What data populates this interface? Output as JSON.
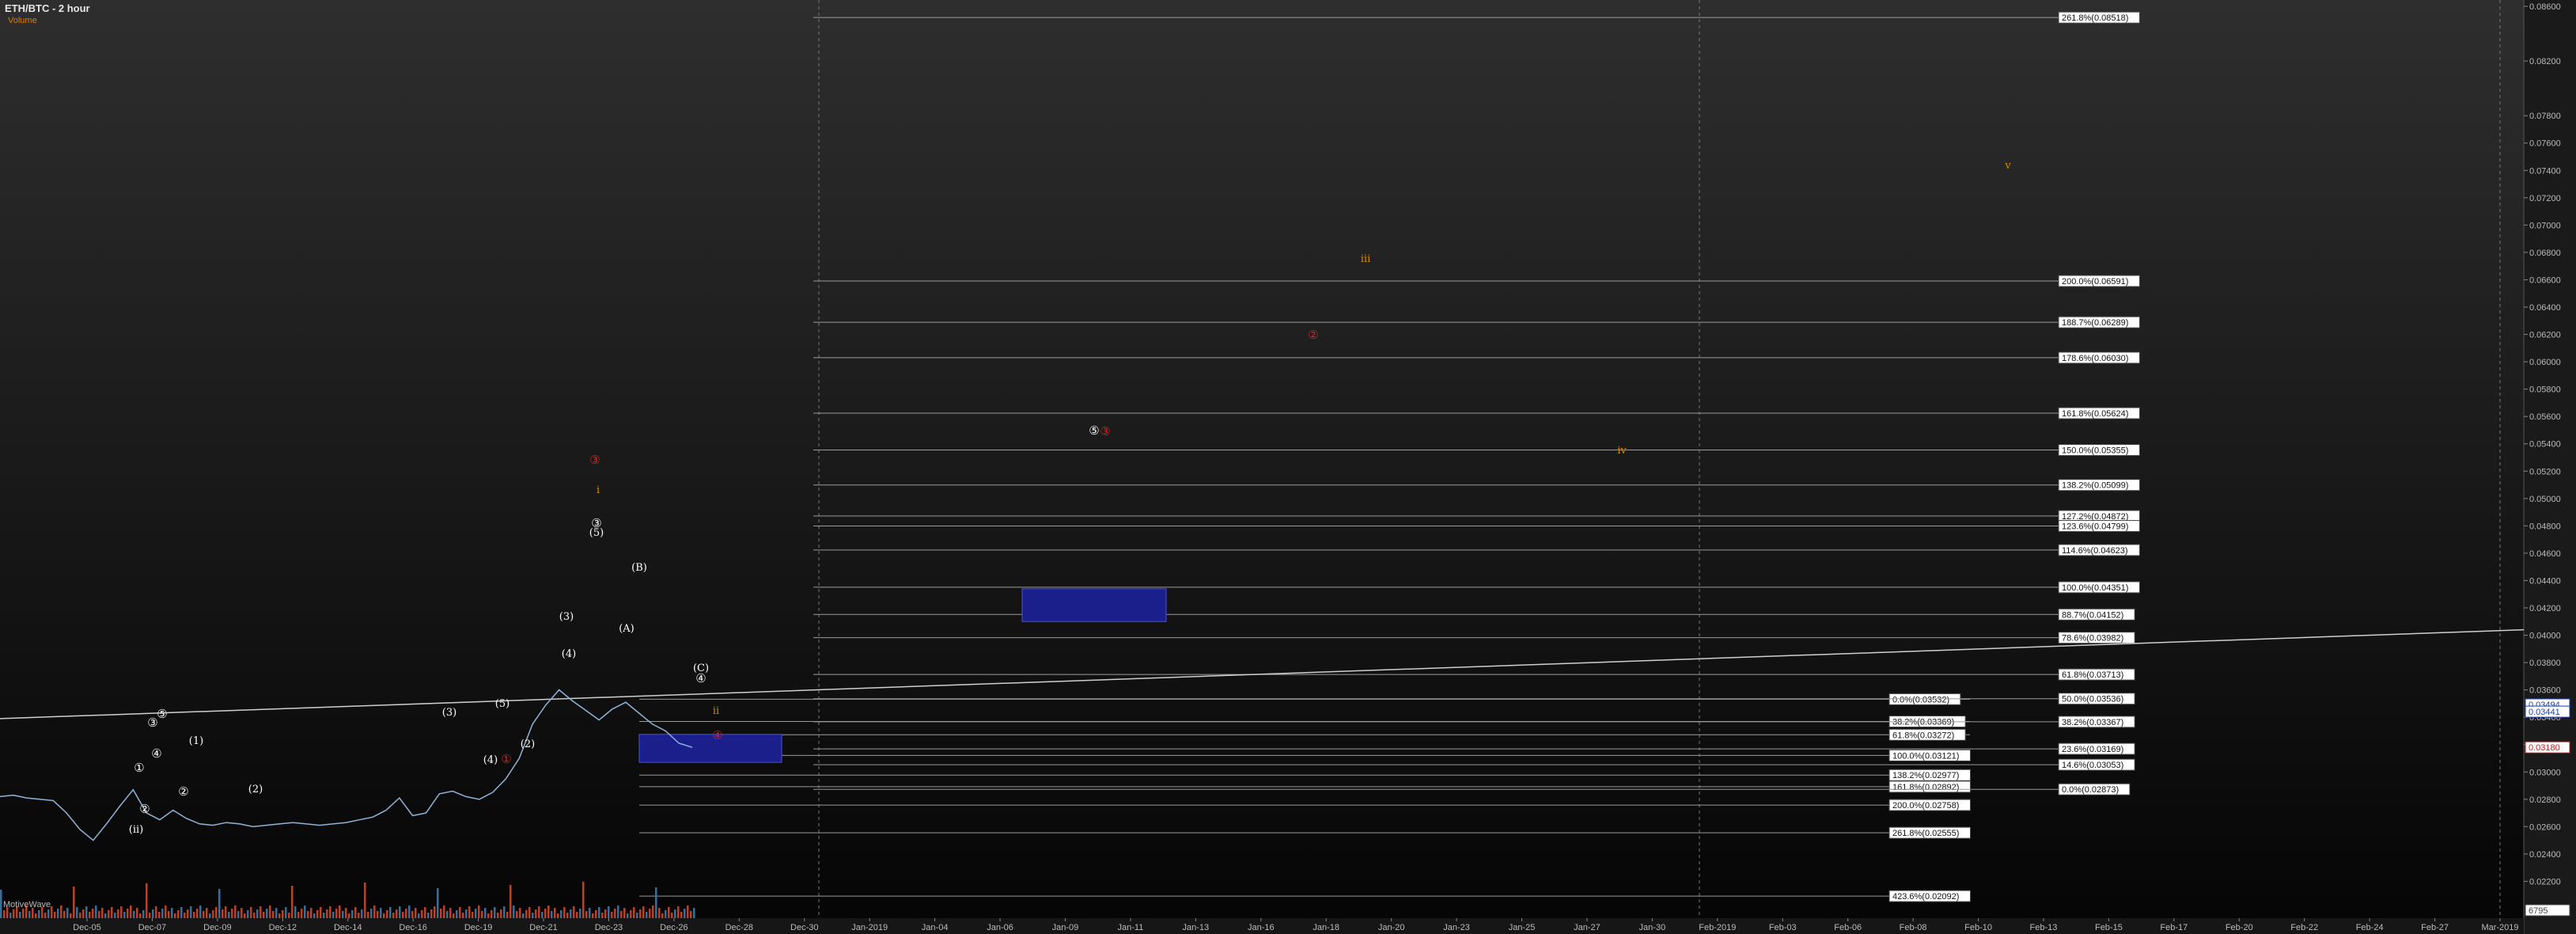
{
  "header": {
    "title": "ETH/BTC - 2 hour",
    "subtitle": "Volume"
  },
  "volume_label": "MotiveWave",
  "colors": {
    "background": "#0b0b0b",
    "price": "#8fb4d8",
    "volume_up": "#3d6d95",
    "volume_down": "#b3452a",
    "blue_box": "#1a1f8c",
    "wave_white": "#ffffff",
    "wave_red": "#e02020",
    "wave_orange": "#d48a00"
  },
  "chart_data": {
    "type": "line",
    "title": "ETH/BTC - 2 hour",
    "y_scale": "linear",
    "y_range": [
      0.02,
      0.086
    ],
    "y_ticks": [
      "0.08600",
      "0.08200",
      "0.07800",
      "0.07600",
      "0.07400",
      "0.07200",
      "0.07000",
      "0.06800",
      "0.06600",
      "0.06400",
      "0.06200",
      "0.06000",
      "0.05800",
      "0.05600",
      "0.05400",
      "0.05200",
      "0.05000",
      "0.04800",
      "0.04600",
      "0.04400",
      "0.04200",
      "0.04000",
      "0.03800",
      "0.03600",
      "0.03400",
      "0.03200",
      "0.03000",
      "0.02800",
      "0.02600",
      "0.02400",
      "0.02200"
    ],
    "x_ticks": [
      "Dec-05",
      "Dec-07",
      "Dec-09",
      "Dec-12",
      "Dec-14",
      "Dec-16",
      "Dec-19",
      "Dec-21",
      "Dec-23",
      "Dec-26",
      "Dec-28",
      "Dec-30",
      "Jan-2019",
      "Jan-04",
      "Jan-06",
      "Jan-09",
      "Jan-11",
      "Jan-13",
      "Jan-16",
      "Jan-18",
      "Jan-20",
      "Jan-23",
      "Jan-25",
      "Jan-27",
      "Jan-30",
      "Feb-2019",
      "Feb-03",
      "Feb-06",
      "Feb-08",
      "Feb-10",
      "Feb-13",
      "Feb-15",
      "Feb-17",
      "Feb-20",
      "Feb-22",
      "Feb-24",
      "Feb-27",
      "Mar-2019"
    ],
    "price_labels": [
      "0.03494",
      "0.03441",
      "0.03180",
      "6795"
    ],
    "series": [
      {
        "values": [
          0.0282,
          0.0283,
          0.0281,
          0.028,
          0.0279,
          0.027,
          0.0258,
          0.025,
          0.0262,
          0.0275,
          0.0287,
          0.027,
          0.0265,
          0.0272,
          0.0266,
          0.0262,
          0.0261,
          0.0263,
          0.0262,
          0.026,
          0.0261,
          0.0262,
          0.0263,
          0.0262,
          0.0261,
          0.0262,
          0.0263,
          0.0265,
          0.0267,
          0.0272,
          0.0281,
          0.0268,
          0.027,
          0.0284,
          0.0286,
          0.0282,
          0.028,
          0.0285,
          0.0295,
          0.031,
          0.0335,
          0.0349,
          0.036,
          0.0352,
          0.0345,
          0.0338,
          0.0346,
          0.0351,
          0.0343,
          0.0335,
          0.033,
          0.0321,
          0.0318
        ]
      }
    ],
    "fib_levels_left": [
      {
        "label": "0.0%(0.03532)",
        "value": 0.03532
      },
      {
        "label": "38.2%(0.03369)",
        "value": 0.03369
      },
      {
        "label": "61.8%(0.03272)",
        "value": 0.03272
      },
      {
        "label": "100.0%(0.03121)",
        "value": 0.03121
      },
      {
        "label": "138.2%(0.02977)",
        "value": 0.02977
      },
      {
        "label": "161.8%(0.02892)",
        "value": 0.02892
      },
      {
        "label": "200.0%(0.02758)",
        "value": 0.02758
      },
      {
        "label": "261.8%(0.02555)",
        "value": 0.02555
      },
      {
        "label": "423.6%(0.02092)",
        "value": 0.02092
      }
    ],
    "fib_levels_right": [
      {
        "label": "261.8%(0.08518)",
        "value": 0.08518
      },
      {
        "label": "200.0%(0.06591)",
        "value": 0.06591
      },
      {
        "label": "188.7%(0.06289)",
        "value": 0.06289
      },
      {
        "label": "178.6%(0.06030)",
        "value": 0.0603
      },
      {
        "label": "161.8%(0.05624)",
        "value": 0.05624
      },
      {
        "label": "150.0%(0.05355)",
        "value": 0.05355
      },
      {
        "label": "138.2%(0.05099)",
        "value": 0.05099
      },
      {
        "label": "127.2%(0.04872)",
        "value": 0.04872
      },
      {
        "label": "123.6%(0.04799)",
        "value": 0.04799
      },
      {
        "label": "114.6%(0.04623)",
        "value": 0.04623
      },
      {
        "label": "100.0%(0.04351)",
        "value": 0.04351
      },
      {
        "label": "88.7%(0.04152)",
        "value": 0.04152
      },
      {
        "label": "78.6%(0.03982)",
        "value": 0.03982
      },
      {
        "label": "61.8%(0.03713)",
        "value": 0.03713
      },
      {
        "label": "50.0%(0.03536)",
        "value": 0.03536
      },
      {
        "label": "38.2%(0.03367)",
        "value": 0.03367
      },
      {
        "label": "23.6%(0.03169)",
        "value": 0.03169
      },
      {
        "label": "14.6%(0.03053)",
        "value": 0.03053
      },
      {
        "label": "0.0%(0.02873)",
        "value": 0.02873
      }
    ],
    "wave_labels": [
      {
        "text": "(ii)",
        "color": "white"
      },
      {
        "text": "①",
        "color": "white"
      },
      {
        "text": "②",
        "color": "white"
      },
      {
        "text": "③",
        "color": "white"
      },
      {
        "text": "④",
        "color": "white"
      },
      {
        "text": "⑤",
        "color": "white"
      },
      {
        "text": "(1)",
        "color": "white"
      },
      {
        "text": "②",
        "color": "white"
      },
      {
        "text": "(2)",
        "color": "white"
      },
      {
        "text": "(3)",
        "color": "white"
      },
      {
        "text": "(4)",
        "color": "white"
      },
      {
        "text": "(5)",
        "color": "white"
      },
      {
        "text": "(2)",
        "color": "white"
      },
      {
        "text": "(3)",
        "color": "white"
      },
      {
        "text": "(4)",
        "color": "white"
      },
      {
        "text": "③",
        "color": "white"
      },
      {
        "text": "(5)",
        "color": "white"
      },
      {
        "text": "(B)",
        "color": "white"
      },
      {
        "text": "(A)",
        "color": "white"
      },
      {
        "text": "(C)",
        "color": "white"
      },
      {
        "text": "④",
        "color": "white"
      },
      {
        "text": "⑤",
        "color": "white"
      },
      {
        "text": "③",
        "color": "red"
      },
      {
        "text": "①",
        "color": "red"
      },
      {
        "text": "②",
        "color": "red"
      },
      {
        "text": "③",
        "color": "red"
      },
      {
        "text": "④",
        "color": "red"
      },
      {
        "text": "i",
        "color": "orange"
      },
      {
        "text": "ii",
        "color": "orange"
      },
      {
        "text": "iii",
        "color": "orange"
      },
      {
        "text": "iv",
        "color": "orange"
      },
      {
        "text": "v",
        "color": "orange"
      }
    ]
  }
}
